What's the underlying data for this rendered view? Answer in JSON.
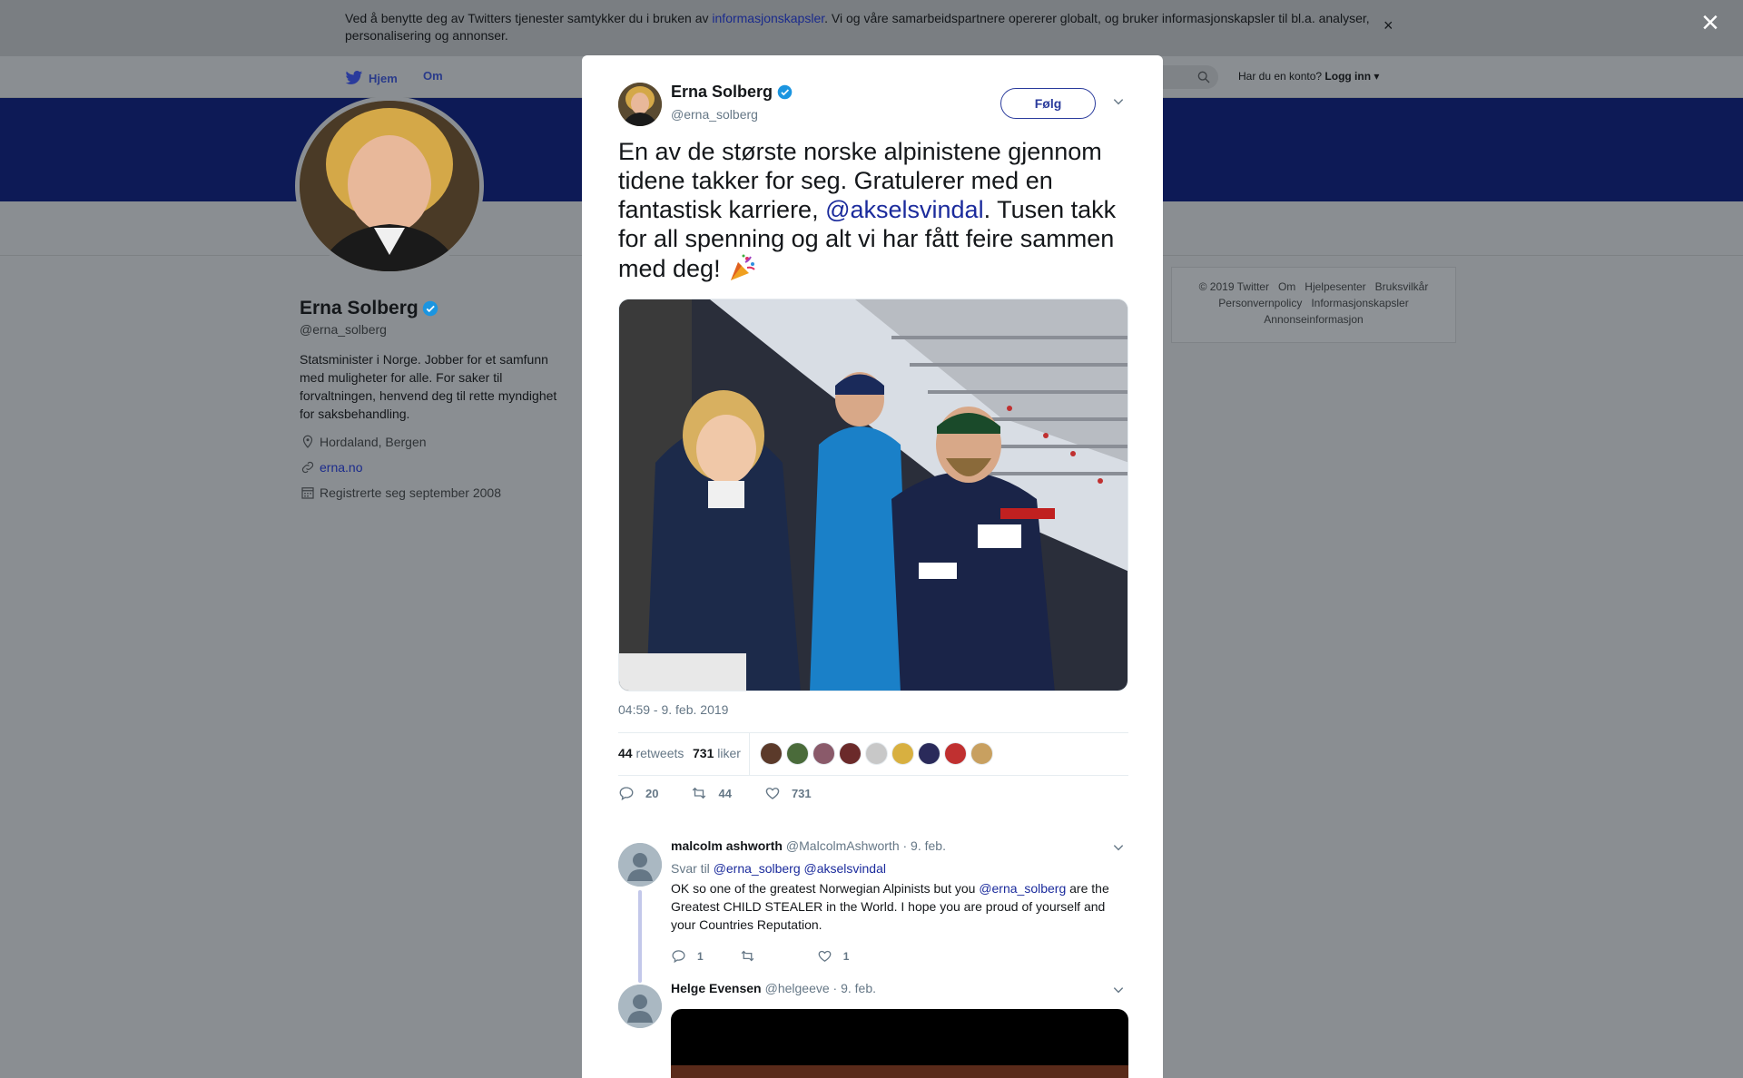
{
  "cookie": {
    "text_before": "Ved å benytte deg av Twitters tjenester samtykker du i bruken av ",
    "link": "informasjonskapsler",
    "text_after": ". Vi og våre samarbeidspartnere opererer globalt, og bruker informasjonskapsler til bl.a. analyser, personalisering og annonser.",
    "close": "×"
  },
  "overlay_close": "×",
  "nav": {
    "home": "Hjem",
    "about": "Om",
    "login_prompt": "Har du en konto?",
    "login": "Logg inn"
  },
  "profile": {
    "name": "Erna Solberg",
    "handle": "@erna_solberg",
    "bio": "Statsminister i Norge. Jobber for et samfunn med muligheter for alle. For saker til forvaltningen, henvend deg til rette myndighet for saksbehandling.",
    "location": "Hordaland, Bergen",
    "website": "erna.no",
    "joined": "Registrerte seg september 2008"
  },
  "footer": {
    "links_row1": [
      "© 2019 Twitter",
      "Om",
      "Hjelpesenter",
      "Bruksvilkår"
    ],
    "links_row2": [
      "Personvernpolicy",
      "Informasjonskapsler"
    ],
    "links_row3": [
      "Annonseinformasjon"
    ]
  },
  "tweet": {
    "name": "Erna Solberg",
    "handle": "@erna_solberg",
    "follow": "Følg",
    "text_part1": "En av de største norske alpinistene gjennom tidene takker for seg. Gratulerer med en fantastisk karriere, ",
    "mention": "@akselsvindal",
    "text_part2": ". Tusen takk for all spenning og alt vi har fått feire sammen med deg! ",
    "timestamp": "04:59 - 9. feb. 2019",
    "retweets_count": "44",
    "retweets_label": "retweets",
    "likes_count": "731",
    "likes_label": "liker",
    "replies": "20",
    "retweets": "44",
    "likes": "731",
    "liker_colors": [
      "#5b3a2a",
      "#4a6b3a",
      "#8a5a6a",
      "#6b2a2a",
      "#c8c8c8",
      "#d8b040",
      "#2a2a5a",
      "#c03030",
      "#c8a060"
    ]
  },
  "replies": [
    {
      "name": "malcolm ashworth",
      "handle": "@MalcolmAshworth",
      "date": "· 9. feb.",
      "reply_to_label": "Svar til",
      "reply_to_1": "@erna_solberg",
      "reply_to_2": "@akselsvindal",
      "text_part1": "OK so one of the greatest Norwegian Alpinists but you ",
      "mention": "@erna_solberg",
      "text_part2": " are the Greatest CHILD STEALER in the World. I hope you are proud of yourself and your Countries Reputation.",
      "replies": "1",
      "likes": "1"
    },
    {
      "name": "Helge Evensen",
      "handle": "@helgeeve",
      "date": "· 9. feb."
    }
  ]
}
